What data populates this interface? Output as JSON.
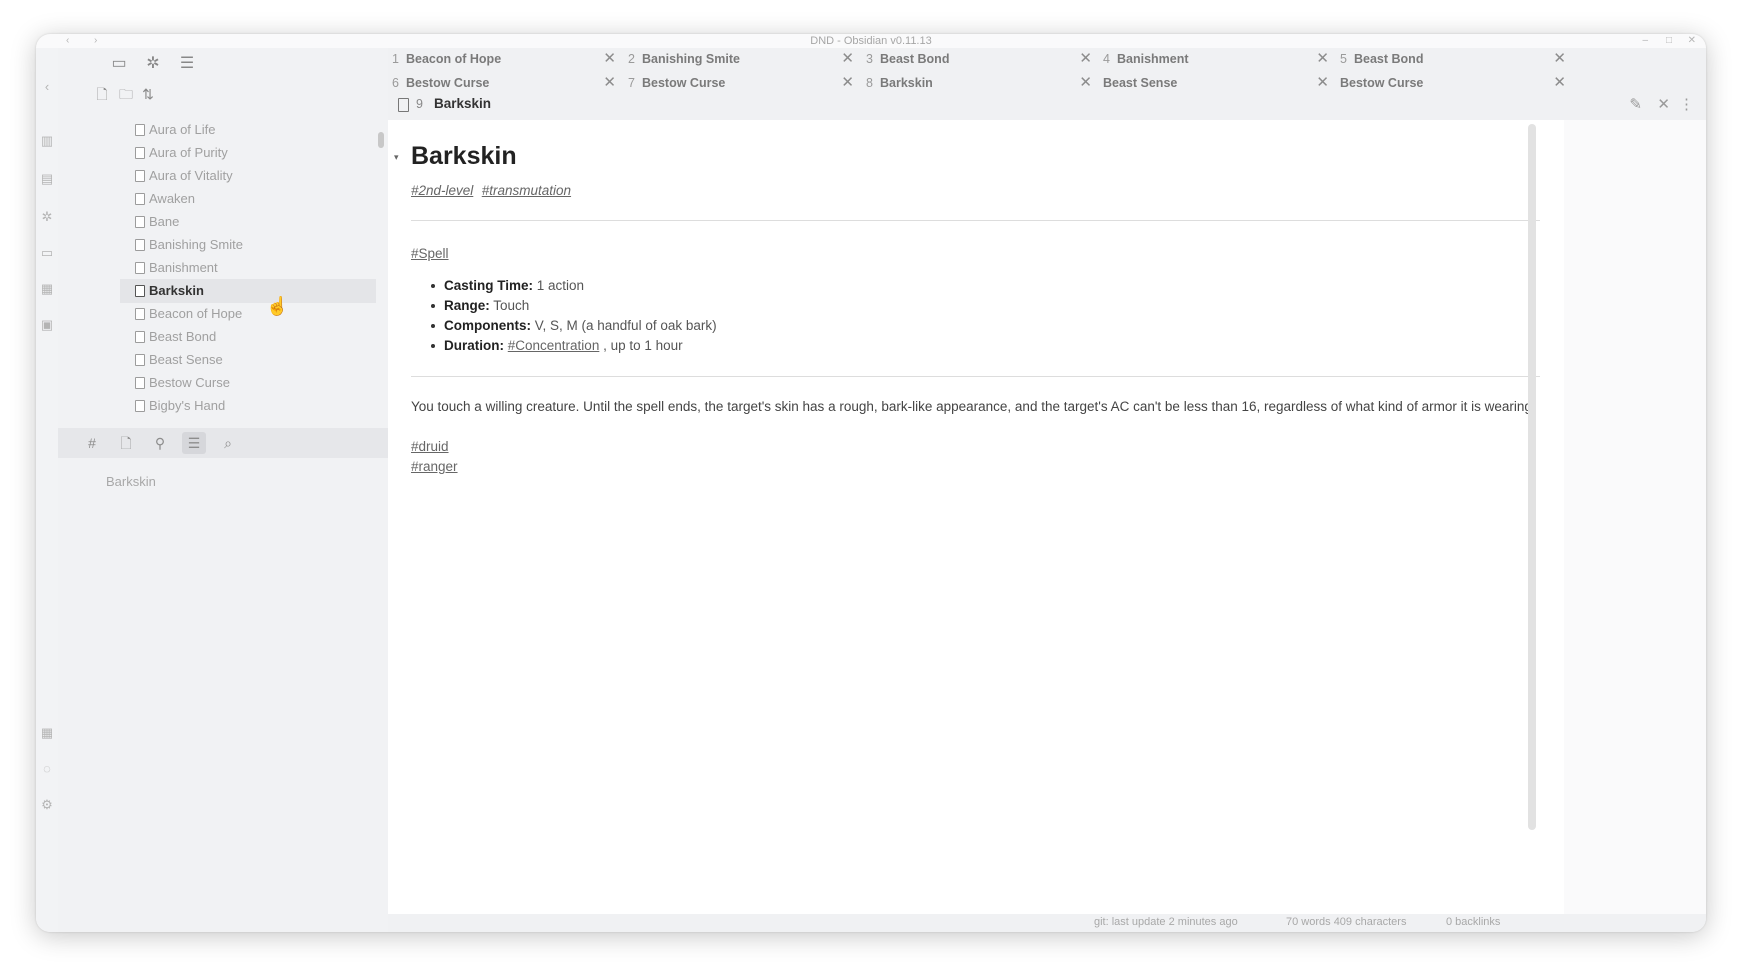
{
  "app": {
    "window_title": "DND - Obsidian v0.11.13"
  },
  "ribbon": {
    "icons": [
      "open-quick-switcher-icon",
      "graph-view-icon",
      "daily-note-icon",
      "templates-icon",
      "command-palette-icon",
      "slides-icon",
      "vault-switch-icon",
      "help-icon",
      "settings-icon"
    ]
  },
  "sidebar": {
    "tabs": [
      "file-explorer-icon",
      "graph-icon",
      "bookmarks-icon"
    ],
    "toolbar": [
      "new-note-icon",
      "new-folder-icon",
      "sort-icon"
    ],
    "files": [
      {
        "label": "Aura of Life"
      },
      {
        "label": "Aura of Purity"
      },
      {
        "label": "Aura of Vitality"
      },
      {
        "label": "Awaken"
      },
      {
        "label": "Bane"
      },
      {
        "label": "Banishing Smite"
      },
      {
        "label": "Banishment"
      },
      {
        "label": "Barkskin"
      },
      {
        "label": "Beacon of Hope"
      },
      {
        "label": "Beast Bond"
      },
      {
        "label": "Beast Sense"
      },
      {
        "label": "Bestow Curse"
      },
      {
        "label": "Bigby's Hand"
      }
    ],
    "active_file_index": 7,
    "bottom_tabs": [
      "tag-pane-icon",
      "file-icon",
      "backlinks-icon",
      "outline-icon",
      "search-icon"
    ],
    "outline_item": "Barkskin"
  },
  "tabs": {
    "row1": [
      {
        "num": "1",
        "label": "Beacon of Hope"
      },
      {
        "num": "2",
        "label": "Banishing Smite"
      },
      {
        "num": "3",
        "label": "Beast Bond"
      },
      {
        "num": "4",
        "label": "Banishment"
      },
      {
        "num": "5",
        "label": "Beast Bond"
      }
    ],
    "row2": [
      {
        "num": "6",
        "label": "Bestow Curse"
      },
      {
        "num": "7",
        "label": "Bestow Curse"
      },
      {
        "num": "8",
        "label": "Barkskin"
      },
      {
        "num": "",
        "label": "Beast Sense"
      },
      {
        "num": "",
        "label": "Bestow Curse"
      }
    ]
  },
  "view_header": {
    "num": "9",
    "title": "Barkskin"
  },
  "note": {
    "title": "Barkskin",
    "tags": [
      "#2nd-level",
      "#transmutation"
    ],
    "spell_tag": "#Spell",
    "properties": [
      {
        "label": "Casting Time:",
        "value": " 1 action"
      },
      {
        "label": "Range:",
        "value": " Touch"
      },
      {
        "label": "Components:",
        "value": " V, S, M (a handful of oak bark)"
      },
      {
        "label": "Duration:",
        "tag": "#Concentration",
        "value": " , up to 1 hour"
      }
    ],
    "body": "You touch a willing creature. Until the spell ends, the target's skin has a rough, bark-like appearance, and the target's AC can't be less than 16, regardless of what kind of armor it is wearing.",
    "class_tags": [
      "#druid",
      "#ranger"
    ]
  },
  "status_bar": {
    "git": "git: last update 2 minutes ago",
    "counts": "70 words 409 characters",
    "backlinks": "0 backlinks"
  }
}
